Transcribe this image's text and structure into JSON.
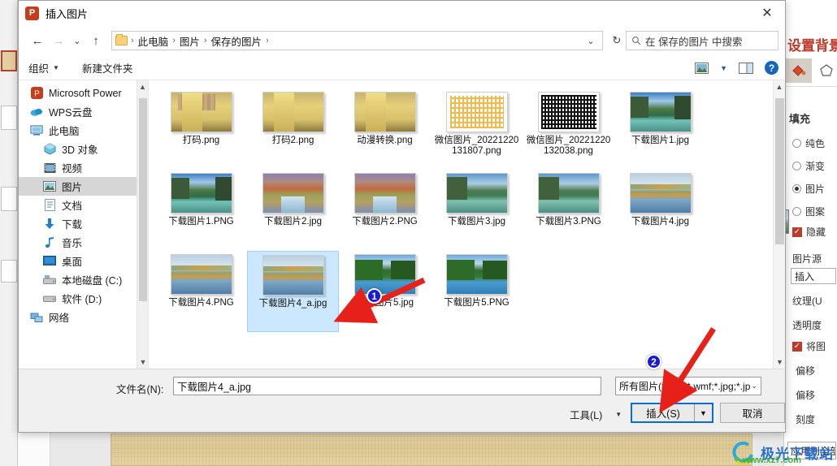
{
  "background_app": {
    "pane_title": "设置背景格式",
    "section_fill": "填充",
    "fill_options": [
      {
        "label": "纯色",
        "selected": false
      },
      {
        "label": "渐变",
        "selected": false
      },
      {
        "label": "图片",
        "selected": true
      },
      {
        "label": "图案",
        "selected": false
      }
    ],
    "hide_checkbox": "隐藏",
    "picture_source_label": "图片源",
    "insert_button": "插入",
    "texture_label": "纹理(U",
    "transparency_label": "透明度",
    "tile_checkbox": "将图",
    "offset_x_label": "偏移",
    "offset_y_label": "偏移",
    "scale_label": "刻度",
    "apply_all_button": "应用到全部"
  },
  "dialog": {
    "title": "插入图片",
    "app_icon": "powerpoint-icon",
    "close_label": "✕",
    "nav": {
      "back": "←",
      "forward": "→",
      "recent": "⌄",
      "up": "↑"
    },
    "breadcrumb": {
      "folder_icon": "folder-icon",
      "items": [
        "此电脑",
        "图片",
        "保存的图片"
      ],
      "separator": "›",
      "dropdown": "⌄",
      "refresh": "↻"
    },
    "search": {
      "icon": "search-icon",
      "placeholder": "在 保存的图片 中搜索"
    },
    "toolbar": {
      "organize": "组织",
      "new_folder": "新建文件夹",
      "view_icon": "view-icon",
      "view_caret": "▼",
      "preview_pane_icon": "preview-pane-icon",
      "help_icon": "?"
    },
    "sidebar": {
      "items": [
        {
          "label": "Microsoft Power",
          "icon": "powerpoint-icon",
          "indent": false,
          "selected": false
        },
        {
          "label": "WPS云盘",
          "icon": "cloud-icon",
          "indent": false,
          "selected": false
        },
        {
          "label": "此电脑",
          "icon": "computer-icon",
          "indent": false,
          "selected": false
        },
        {
          "label": "3D 对象",
          "icon": "3d-object-icon",
          "indent": true,
          "selected": false
        },
        {
          "label": "视频",
          "icon": "video-icon",
          "indent": true,
          "selected": false
        },
        {
          "label": "图片",
          "icon": "pictures-icon",
          "indent": true,
          "selected": true
        },
        {
          "label": "文档",
          "icon": "documents-icon",
          "indent": true,
          "selected": false
        },
        {
          "label": "下载",
          "icon": "downloads-icon",
          "indent": true,
          "selected": false
        },
        {
          "label": "音乐",
          "icon": "music-icon",
          "indent": true,
          "selected": false
        },
        {
          "label": "桌面",
          "icon": "desktop-icon",
          "indent": true,
          "selected": false
        },
        {
          "label": "本地磁盘 (C:)",
          "icon": "drive-icon",
          "indent": true,
          "selected": false
        },
        {
          "label": "软件 (D:)",
          "icon": "drive-icon",
          "indent": true,
          "selected": false
        },
        {
          "label": "网络",
          "icon": "network-icon",
          "indent": false,
          "selected": false
        }
      ]
    },
    "files": [
      {
        "name": "打码.png",
        "art": "art-girl mosaic",
        "selected": false
      },
      {
        "name": "打码2.png",
        "art": "art-girl",
        "selected": false
      },
      {
        "name": "动漫转换.png",
        "art": "art-girl",
        "selected": false
      },
      {
        "name": "微信图片_20221220131807.png",
        "art": "art-qr-y",
        "selected": false
      },
      {
        "name": "微信图片_20221220132038.png",
        "art": "art-qr-k",
        "selected": false
      },
      {
        "name": "下载图片1.jpg",
        "art": "art-lake",
        "selected": false
      },
      {
        "name": "下载图片1.PNG",
        "art": "art-lake",
        "selected": false
      },
      {
        "name": "下载图片2.jpg",
        "art": "art-canyon",
        "selected": false
      },
      {
        "name": "下载图片2.PNG",
        "art": "art-canyon",
        "selected": false
      },
      {
        "name": "下载图片3.jpg",
        "art": "art-lake2",
        "selected": false
      },
      {
        "name": "下载图片3.PNG",
        "art": "art-lake2",
        "selected": false
      },
      {
        "name": "下载图片4.jpg",
        "art": "art-autumn",
        "selected": false
      },
      {
        "name": "下载图片4.PNG",
        "art": "art-autumn",
        "selected": false
      },
      {
        "name": "下载图片4_a.jpg",
        "art": "art-autumn",
        "selected": true
      },
      {
        "name": "下载图片5.jpg",
        "art": "art-green",
        "selected": false
      },
      {
        "name": "下载图片5.PNG",
        "art": "art-green",
        "selected": false
      }
    ],
    "footer": {
      "filename_label": "文件名(N):",
      "filename_value": "下载图片4_a.jpg",
      "filetype_value": "所有图片(*.emf;*.wmf;*.jpg;*.jp",
      "filetype_caret": "⌄",
      "tools_button": "工具(L)",
      "tools_caret": "▼",
      "insert_button": "插入(S)",
      "insert_split_caret": "▼",
      "cancel_button": "取消"
    }
  },
  "annotations": [
    {
      "badge": "1",
      "target": "selected-file"
    },
    {
      "badge": "2",
      "target": "insert-button"
    }
  ],
  "watermark": {
    "title": "极光下载站",
    "url": "www.xz7.com"
  },
  "colors": {
    "accent_blue": "#0a6ed1",
    "selection_blue": "#cce8ff",
    "annotation_red": "#e8201a",
    "badge_blue": "#1a1ad6",
    "ppt_orange": "#c43e1c"
  }
}
